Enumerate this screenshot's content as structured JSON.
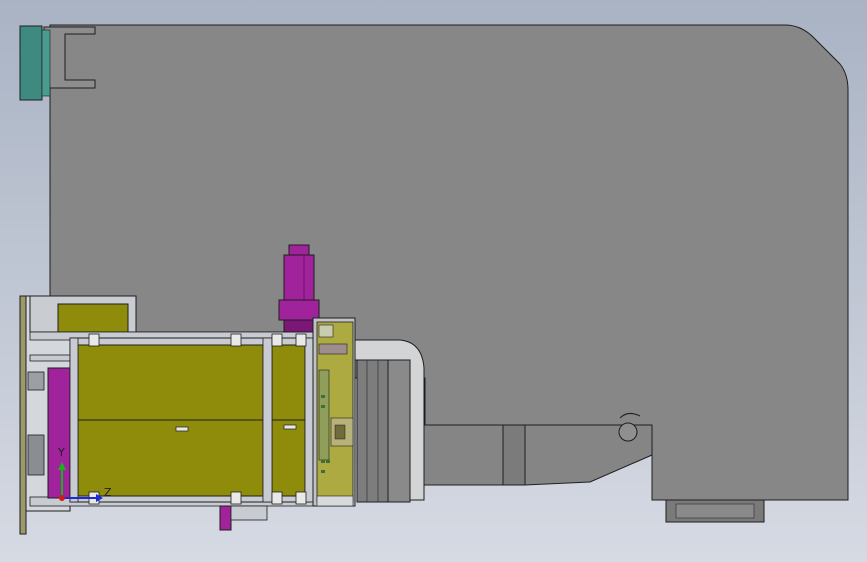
{
  "viewport": {
    "background_top": "#a9b3c4",
    "background_bottom": "#d6dae3"
  },
  "colors": {
    "body_gray": "#878787",
    "body_gray_dark": "#6f6f6f",
    "edge": "#1e1e1e",
    "teal": "#3f8a80",
    "olive": "#8e8c0a",
    "olive_light": "#a5a214",
    "magenta": "#a0239b",
    "magenta_dark": "#7c1778",
    "rail": "#c8ccd2",
    "light_panel": "#bfc3c8",
    "green_detail": "#3f6e3b"
  },
  "triad": {
    "y_label": "Y",
    "z_label": "Z",
    "y_color": "#19b21c",
    "z_color": "#1d2ad6",
    "x_color": "#d11a1a"
  }
}
